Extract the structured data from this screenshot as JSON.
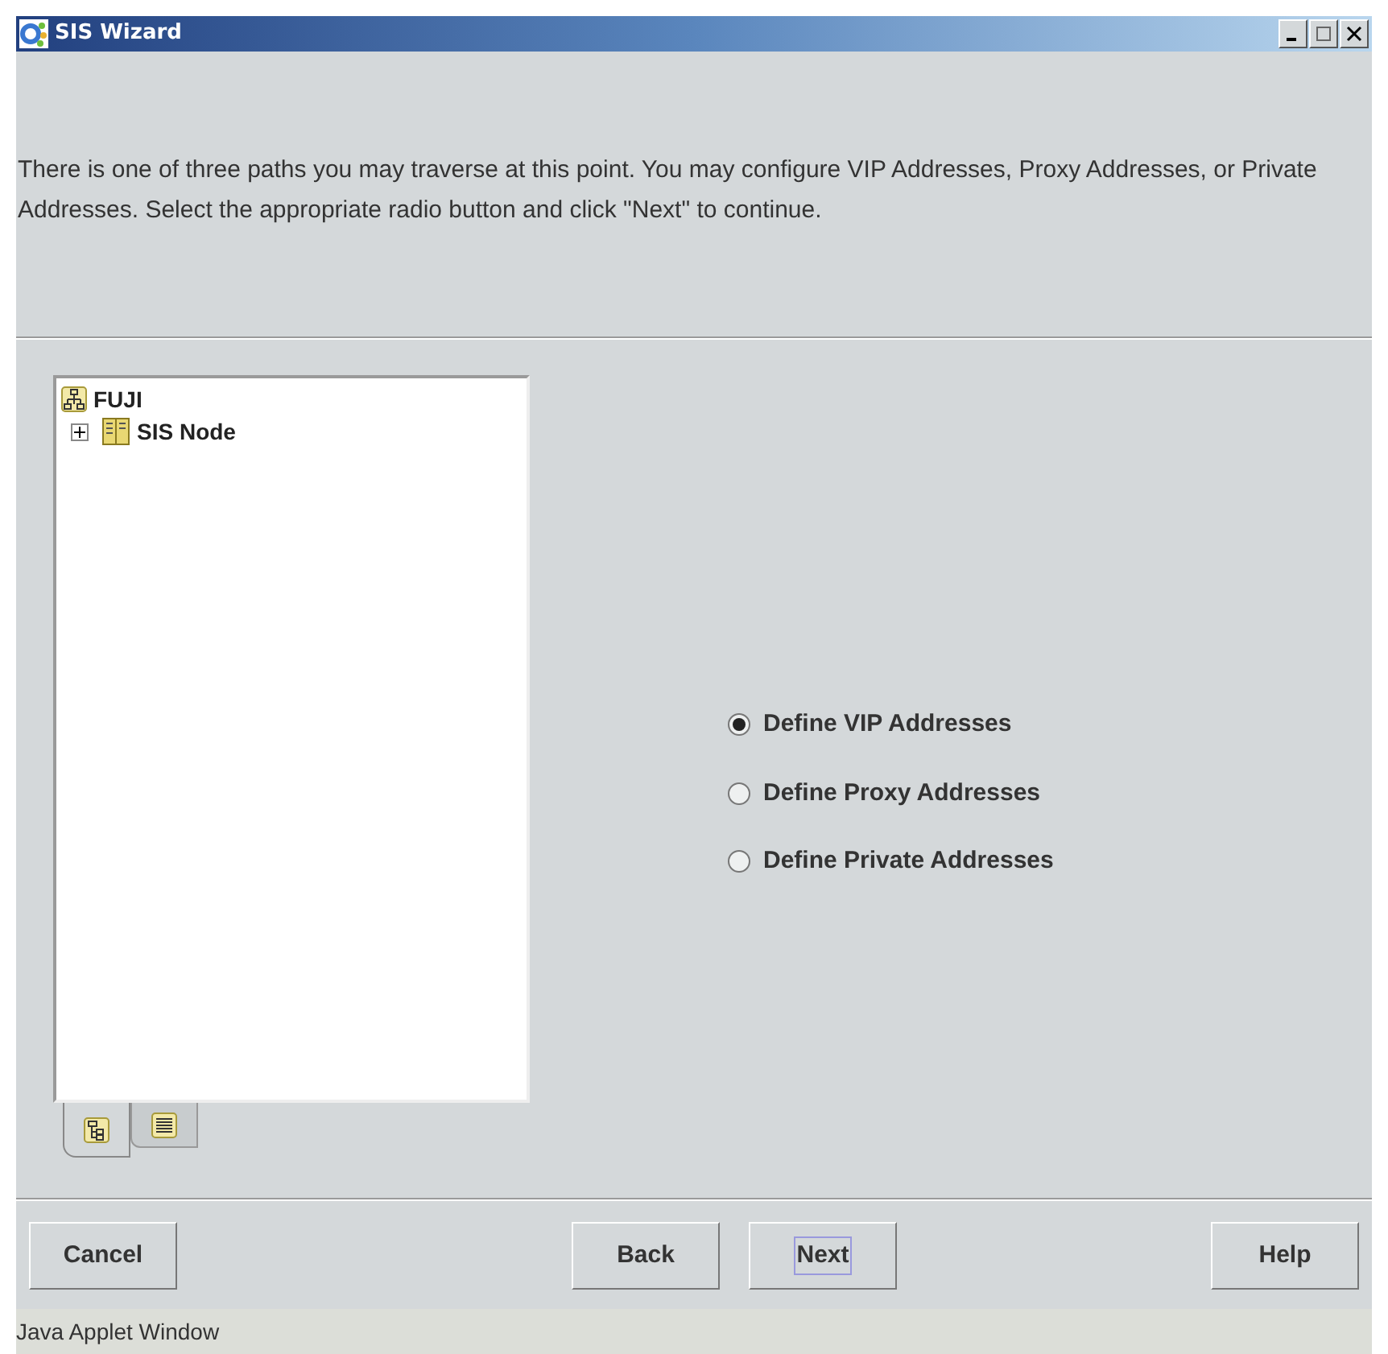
{
  "window": {
    "title": "SIS Wizard"
  },
  "instructions": "There is one of three paths you may traverse at this point.  You may configure VIP Addresses, Proxy Addresses, or Private Addresses.  Select the appropriate radio button and click \"Next\" to continue.",
  "tree": [
    {
      "label": "FUJI",
      "kind": "cluster",
      "children": [
        {
          "label": "SIS Node",
          "kind": "node",
          "expanded": false
        }
      ]
    }
  ],
  "view_tabs": [
    {
      "kind": "tree",
      "selected": true
    },
    {
      "kind": "list",
      "selected": false
    }
  ],
  "options": [
    {
      "label": "Define VIP Addresses",
      "selected": true
    },
    {
      "label": "Define Proxy Addresses",
      "selected": false
    },
    {
      "label": "Define Private Addresses",
      "selected": false
    }
  ],
  "buttons": [
    {
      "label": "Cancel",
      "focused": false
    },
    {
      "label": "Back",
      "focused": false
    },
    {
      "label": "Next",
      "focused": true
    },
    {
      "label": "Help",
      "focused": false
    }
  ],
  "status_bar": "Java Applet Window"
}
